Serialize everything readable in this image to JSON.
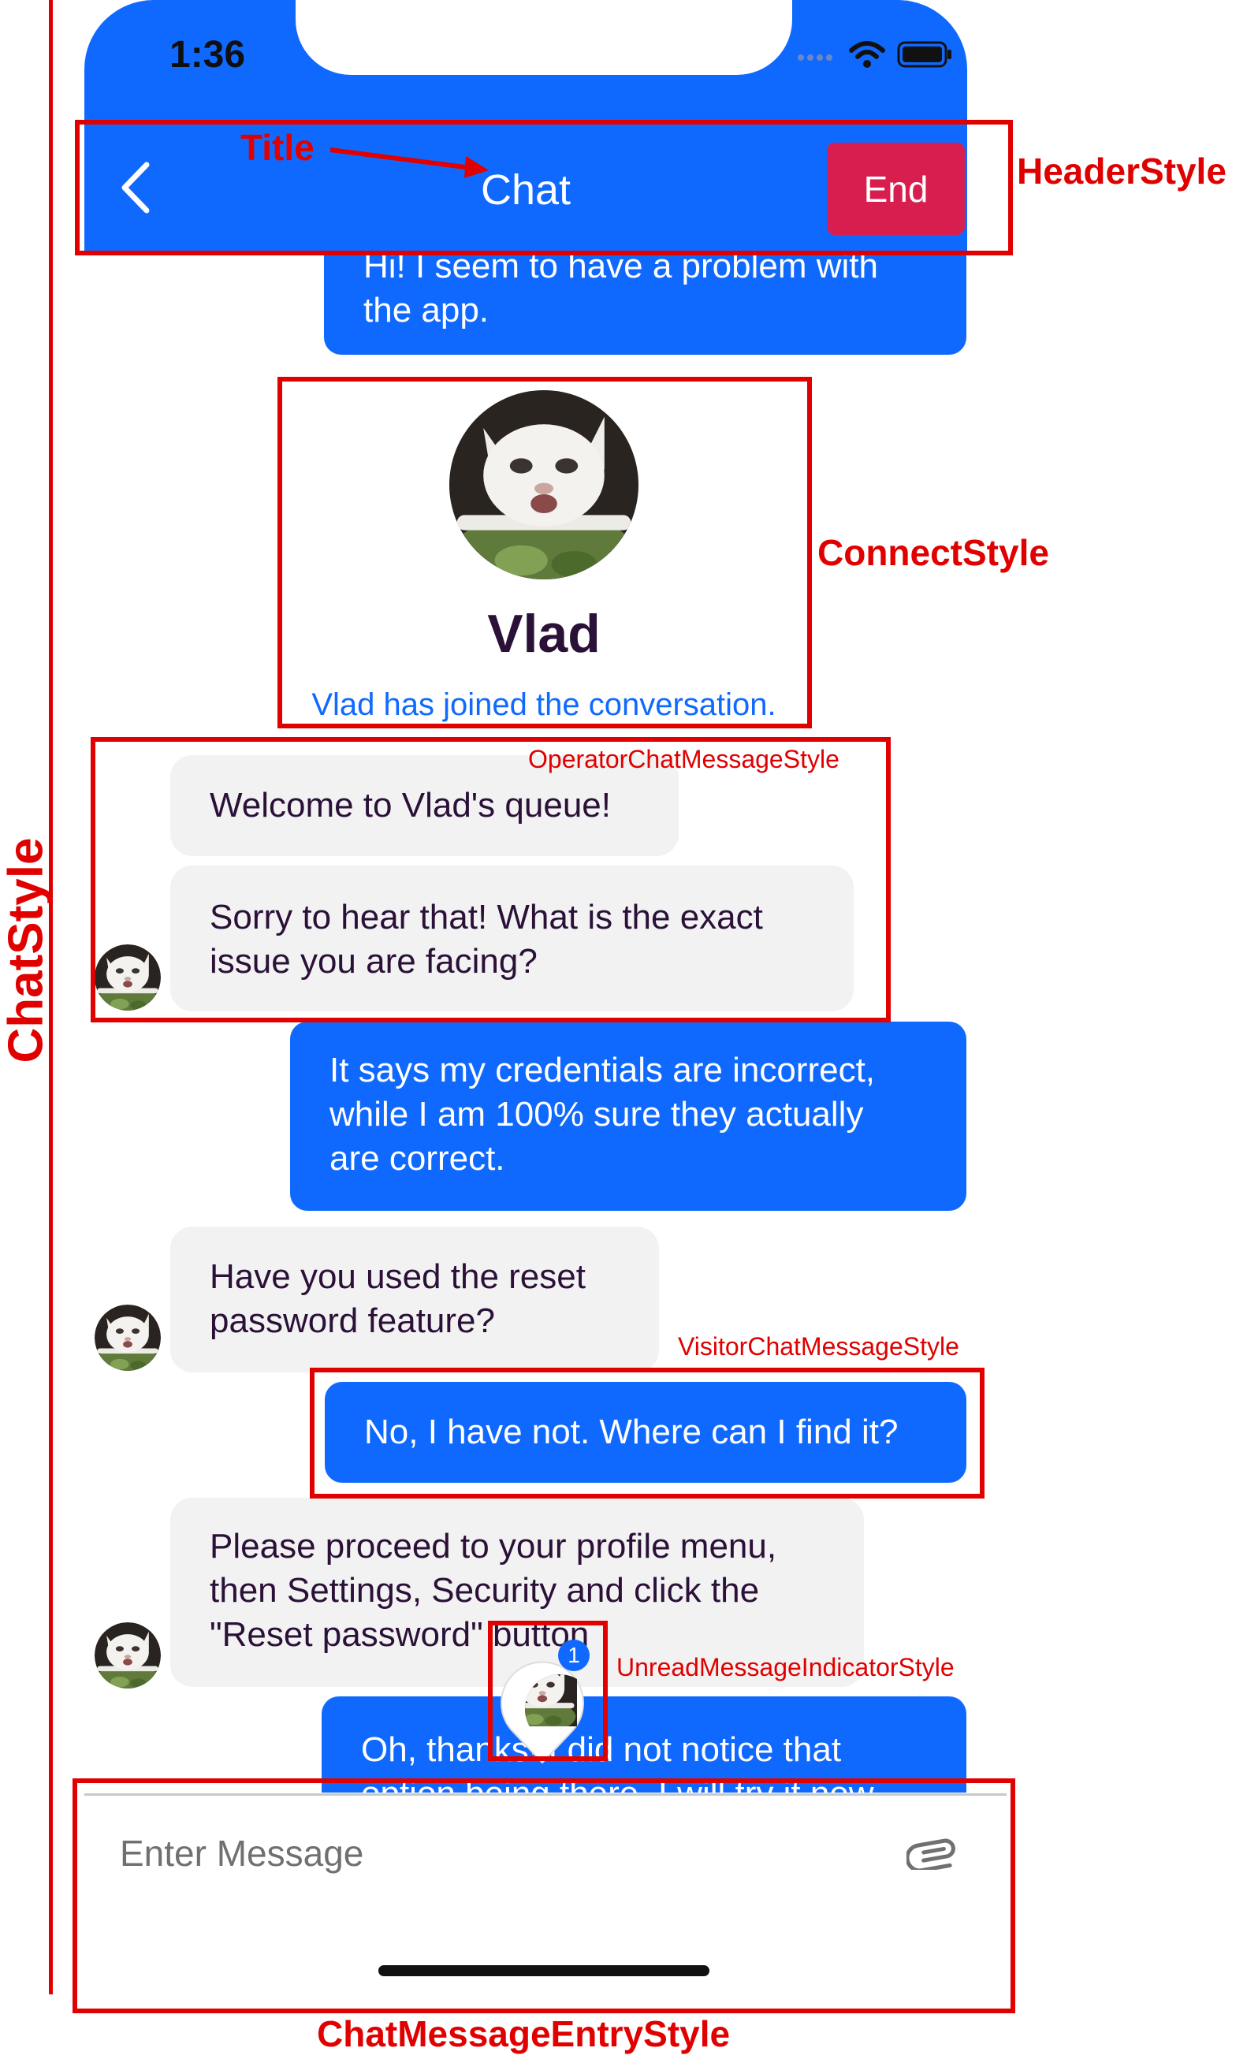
{
  "status_bar": {
    "time": "1:36"
  },
  "header": {
    "title": "Chat",
    "end_label": "End"
  },
  "connect": {
    "operator_name": "Vlad",
    "joined_text": "Vlad has joined the conversation."
  },
  "messages": [
    {
      "from": "visitor",
      "lines": [
        "Hi! I seem to have a problem with",
        "the app."
      ]
    },
    {
      "from": "operator",
      "lines": [
        "Welcome to Vlad's queue!"
      ]
    },
    {
      "from": "operator",
      "lines": [
        "Sorry to hear that! What is the exact",
        "issue you are facing?"
      ]
    },
    {
      "from": "visitor",
      "lines": [
        "It says my credentials are incorrect,",
        "while I am 100% sure they actually",
        "are correct."
      ]
    },
    {
      "from": "operator",
      "lines": [
        "Have you used the reset",
        "password feature?"
      ]
    },
    {
      "from": "visitor",
      "lines": [
        "No, I have not. Where can I find it?"
      ]
    },
    {
      "from": "operator",
      "lines": [
        "Please proceed to your profile menu,",
        "then Settings, Security and click the",
        "\"Reset password\" button"
      ]
    },
    {
      "from": "visitor",
      "lines": [
        "Oh, thanks! I did not notice that",
        "option being there. I will try it now."
      ]
    }
  ],
  "unread_indicator": {
    "count": "1"
  },
  "entry": {
    "placeholder": "Enter Message"
  },
  "annotations": {
    "title": "Title",
    "header_style": "HeaderStyle",
    "connect_style": "ConnectStyle",
    "chat_style": "ChatStyle",
    "operator_message_style": "OperatorChatMessageStyle",
    "visitor_message_style": "VisitorChatMessageStyle",
    "unread_indicator_style": "UnreadMessageIndicatorStyle",
    "entry_style": "ChatMessageEntryStyle"
  },
  "colors": {
    "brand_blue": "#1069ff",
    "end_button": "#d81e4f",
    "operator_bubble": "#f2f2f2",
    "operator_text": "#2b1038",
    "annotation_red": "#e00000"
  },
  "icons": [
    "back-chevron-icon",
    "wifi-icon",
    "signal-icon",
    "battery-icon",
    "paperclip-icon"
  ]
}
